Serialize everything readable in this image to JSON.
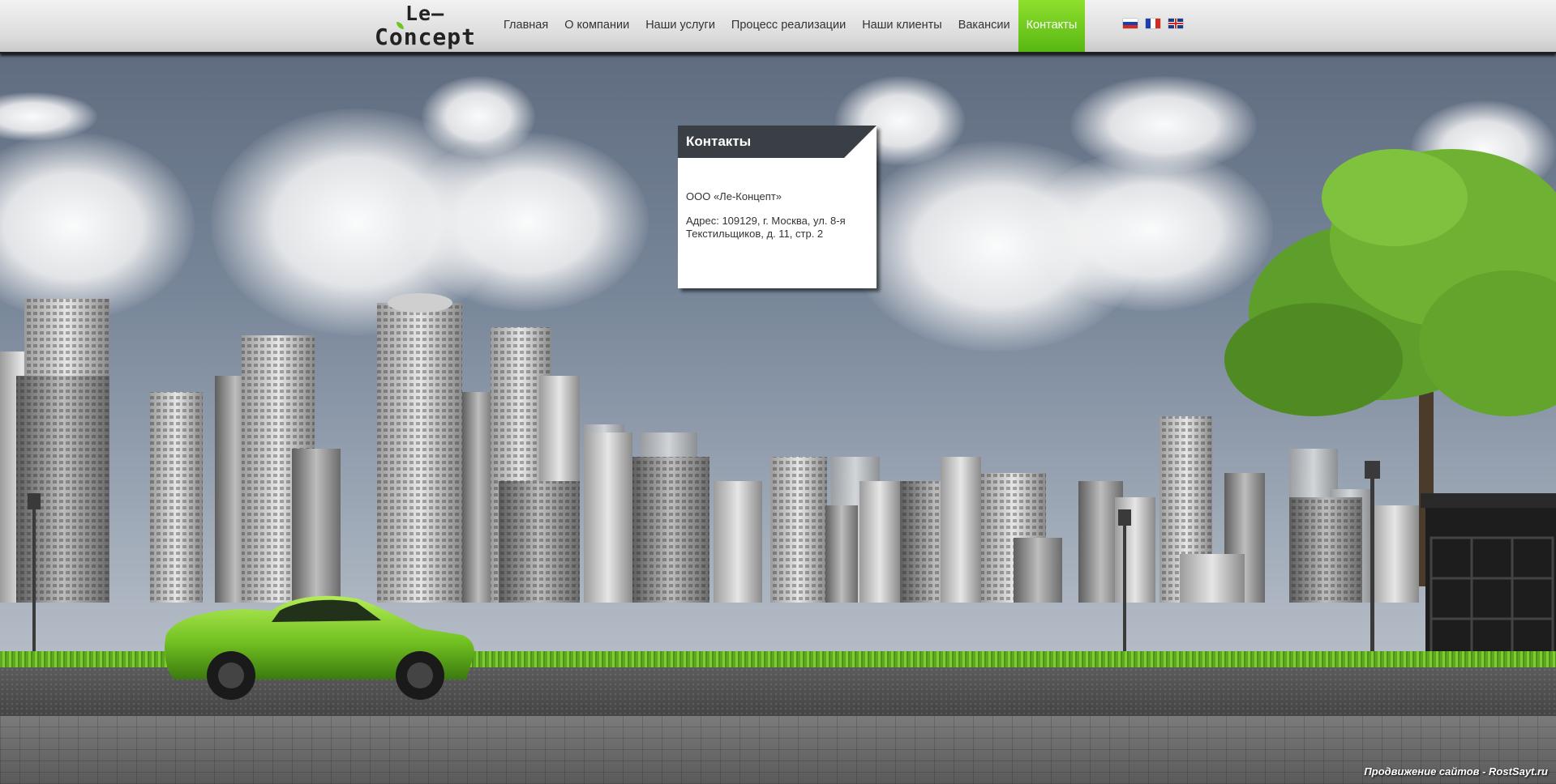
{
  "logo": {
    "line1": "Le–",
    "line2": "Concept"
  },
  "nav": {
    "items": [
      {
        "label": "Главная"
      },
      {
        "label": "О компании"
      },
      {
        "label": "Наши услуги"
      },
      {
        "label": "Процесс реализации"
      },
      {
        "label": "Наши клиенты"
      },
      {
        "label": "Вакансии"
      },
      {
        "label": "Контакты"
      }
    ],
    "active_index": 6
  },
  "languages": [
    "russian-flag-icon",
    "french-flag-icon",
    "english-flag-icon"
  ],
  "colors": {
    "accent": "#6ec51e",
    "panel_header": "#3a3f45"
  },
  "contacts": {
    "title": "Контакты",
    "company": "ООО «Ле-Концепт»",
    "address": "Адрес: 109129, г. Москва, ул. 8-я Текстильщиков, д. 11, стр. 2"
  },
  "footer": {
    "credit": "Продвижение сайтов - RostSayt.ru"
  }
}
